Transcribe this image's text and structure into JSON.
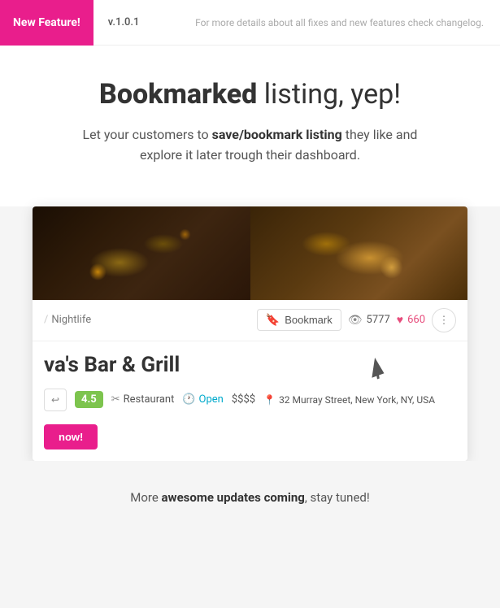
{
  "topbar": {
    "badge_label": "New Feature!",
    "version": "v.1.0.1",
    "changelog": "For more details about all fixes and new features check changelog."
  },
  "hero": {
    "title_bold": "Bookmarked",
    "title_rest": " listing, yep!",
    "subtitle_plain1": "Let your customers to ",
    "subtitle_bold": "save/bookmark listing",
    "subtitle_plain2": " they like and explore it later trough their dashboard."
  },
  "card": {
    "breadcrumb_sep": "/",
    "breadcrumb_item": "Nightlife",
    "bookmark_label": "Bookmark",
    "views_count": "5777",
    "likes_count": "660",
    "listing_title": "va's Bar & Grill",
    "rating": "4.5",
    "category": "Restaurant",
    "status": "Open",
    "price": "$$$$",
    "address": "32 Murray Street, New York, NY, USA"
  },
  "footer": {
    "text_plain1": "More ",
    "text_bold": "awesome updates coming",
    "text_plain2": ", stay tuned!"
  },
  "buttons": {
    "book_now": "now!"
  }
}
